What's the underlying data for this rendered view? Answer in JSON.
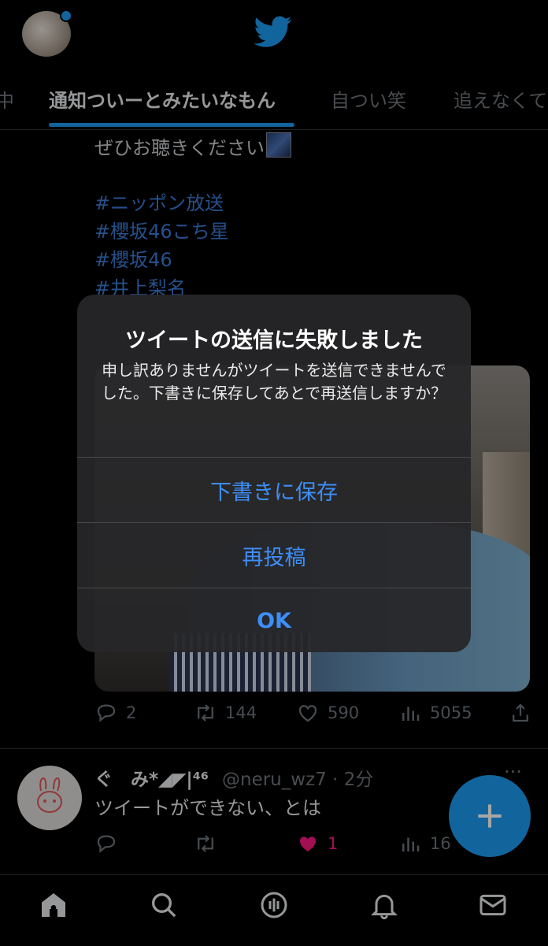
{
  "tabs": [
    "中",
    "通知ついーとみたいなもん",
    "自つい笑",
    "追えなくて"
  ],
  "tweet1": {
    "text": "ぜひお聴きください",
    "hashtags": [
      "#ニッポン放送",
      "#櫻坂46こち星",
      "#櫻坂46",
      "#井上梨名"
    ],
    "stats": {
      "replies": "2",
      "retweets": "144",
      "likes": "590",
      "views": "5055"
    }
  },
  "tweet2": {
    "name": "ぐ　み*◢◤|⁴⁶",
    "handle": "@neru_wz7 · 2分",
    "more": "···",
    "text": "ツイートができない、とは",
    "stats": {
      "likes": "1",
      "views": "16"
    }
  },
  "dialog": {
    "title": "ツイートの送信に失敗しました",
    "message": "申し訳ありませんがツイートを送信できませんでした。下書きに保存してあとで再送信しますか？",
    "buttons": [
      "下書きに保存",
      "再投稿",
      "OK"
    ]
  },
  "colors": {
    "accent": "#1d9bf0",
    "dialog_button": "#3d8ef8",
    "like_active": "#f91880",
    "hashtag": "#3b7bd6"
  },
  "icons": [
    "twitter-bird-icon",
    "reply-icon",
    "retweet-icon",
    "like-icon",
    "views-icon",
    "share-icon",
    "compose-icon",
    "home-icon",
    "search-icon",
    "spaces-icon",
    "notifications-icon",
    "messages-icon"
  ]
}
